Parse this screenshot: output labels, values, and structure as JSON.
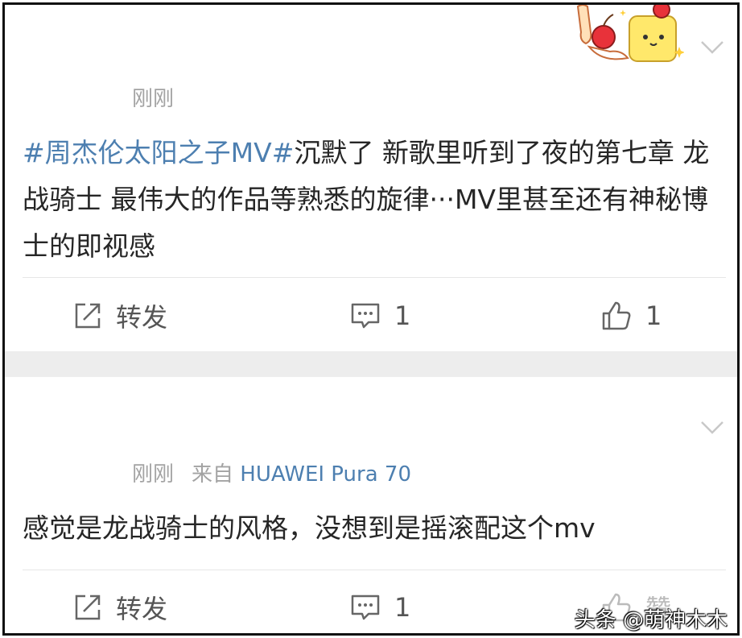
{
  "post1": {
    "time": "刚刚",
    "topic": "#周杰伦太阳之子MV#",
    "text": "沉默了 新歌里听到了夜的第七章 龙战骑士 最伟大的作品等熟悉的旋律···MV里甚至还有神秘博士的即视感",
    "actions": {
      "repost_label": "转发",
      "comment_count": "1",
      "like_count": "1"
    }
  },
  "post2": {
    "time": "刚刚",
    "source_prefix": "来自",
    "device": "HUAWEI Pura 70",
    "text": "感觉是龙战骑士的风格，没想到是摇滚配这个mv",
    "actions": {
      "repost_label": "转发",
      "comment_count": "1",
      "like_label_partial": "赞"
    }
  },
  "watermark": "头条 @萌神木木",
  "colors": {
    "topic": "#4d7fb0",
    "meta": "#a3a3a3",
    "separator": "#ededed"
  }
}
